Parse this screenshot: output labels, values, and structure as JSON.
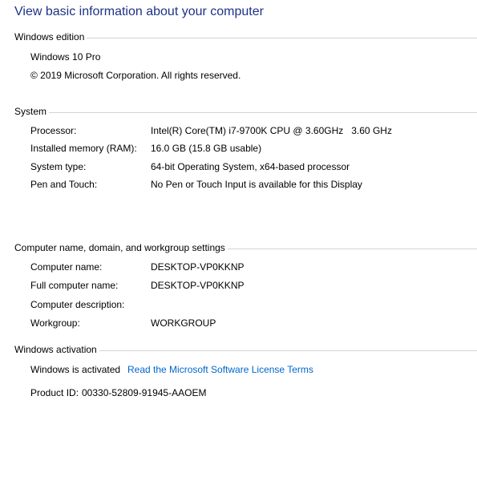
{
  "title": "View basic information about your computer",
  "edition": {
    "header": "Windows edition",
    "name": "Windows 10 Pro",
    "copyright": "© 2019 Microsoft Corporation. All rights reserved."
  },
  "system": {
    "header": "System",
    "rows": [
      {
        "label": "Processor:",
        "value": "Intel(R) Core(TM) i7-9700K CPU @ 3.60GHz   3.60 GHz"
      },
      {
        "label": "Installed memory (RAM):",
        "value": "16.0 GB (15.8 GB usable)"
      },
      {
        "label": "System type:",
        "value": "64-bit Operating System, x64-based processor"
      },
      {
        "label": "Pen and Touch:",
        "value": "No Pen or Touch Input is available for this Display"
      }
    ]
  },
  "computer": {
    "header": "Computer name, domain, and workgroup settings",
    "rows": [
      {
        "label": "Computer name:",
        "value": "DESKTOP-VP0KKNP"
      },
      {
        "label": "Full computer name:",
        "value": "DESKTOP-VP0KKNP"
      },
      {
        "label": "Computer description:",
        "value": ""
      },
      {
        "label": "Workgroup:",
        "value": "WORKGROUP"
      }
    ]
  },
  "activation": {
    "header": "Windows activation",
    "status": "Windows is activated",
    "license_link": "Read the Microsoft Software License Terms",
    "product_id_label": "Product ID:",
    "product_id": "00330-52809-91945-AAOEM"
  }
}
